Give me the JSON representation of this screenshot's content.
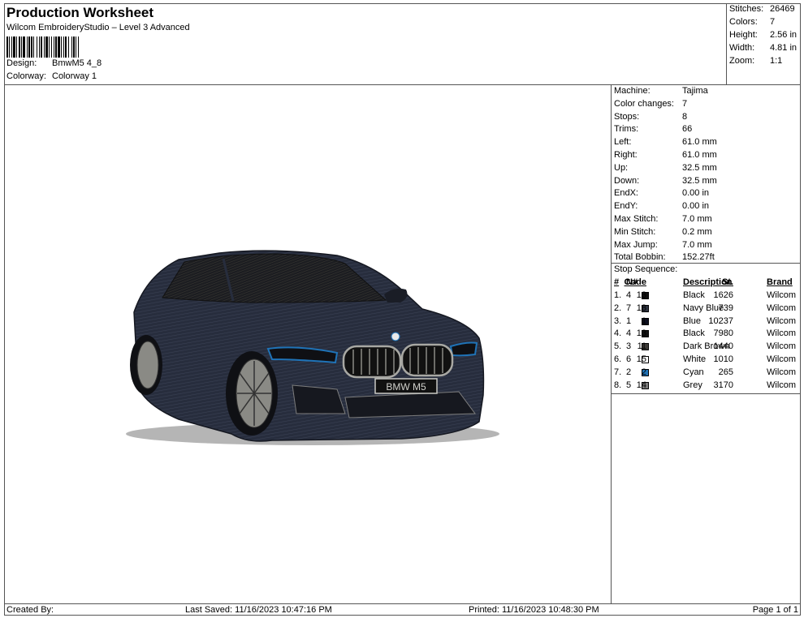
{
  "header": {
    "title": "Production Worksheet",
    "subtitle": "Wilcom EmbroideryStudio – Level 3 Advanced",
    "design_label": "Design:",
    "design_value": "BmwM5 4_8",
    "colorway_label": "Colorway:",
    "colorway_value": "Colorway 1"
  },
  "stats": {
    "stitches_label": "Stitches:",
    "stitches_value": "26469",
    "colors_label": "Colors:",
    "colors_value": "7",
    "height_label": "Height:",
    "height_value": "2.56 in",
    "width_label": "Width:",
    "width_value": "4.81 in",
    "zoom_label": "Zoom:",
    "zoom_value": "1:1"
  },
  "machine": [
    {
      "label": "Machine:",
      "value": "Tajima"
    },
    {
      "label": "Color changes:",
      "value": "7"
    },
    {
      "label": "Stops:",
      "value": "8"
    },
    {
      "label": "Trims:",
      "value": "66"
    },
    {
      "label": "Left:",
      "value": "61.0 mm"
    },
    {
      "label": "Right:",
      "value": "61.0 mm"
    },
    {
      "label": "Up:",
      "value": "32.5 mm"
    },
    {
      "label": "Down:",
      "value": "32.5 mm"
    },
    {
      "label": "EndX:",
      "value": "0.00 in"
    },
    {
      "label": "EndY:",
      "value": "0.00 in"
    },
    {
      "label": "Max Stitch:",
      "value": "7.0 mm"
    },
    {
      "label": "Min Stitch:",
      "value": "0.2 mm"
    },
    {
      "label": "Max Jump:",
      "value": "7.0 mm"
    },
    {
      "label": "Total Bobbin:",
      "value": "152.27ft"
    }
  ],
  "sequence": {
    "title": "Stop Sequence:",
    "headers": {
      "num": "#",
      "n": "N#",
      "st": "St.",
      "desc": "Description",
      "code": "Code",
      "brand": "Brand"
    },
    "rows": [
      {
        "num": "1.",
        "n": "4",
        "color": "#111111",
        "st": "1626",
        "desc": "Black",
        "code": "13",
        "brand": "Wilcom"
      },
      {
        "num": "2.",
        "n": "7",
        "color": "#2e3440",
        "st": "739",
        "desc": "Navy Blue",
        "code": "18",
        "brand": "Wilcom"
      },
      {
        "num": "3.",
        "n": "1",
        "color": "#0c0f1e",
        "st": "10237",
        "desc": "Blue",
        "code": "1",
        "brand": "Wilcom"
      },
      {
        "num": "4.",
        "n": "4",
        "color": "#111111",
        "st": "7980",
        "desc": "Black",
        "code": "13",
        "brand": "Wilcom"
      },
      {
        "num": "5.",
        "n": "3",
        "color": "#3d3b38",
        "st": "1440",
        "desc": "Dark Brown",
        "code": "11",
        "brand": "Wilcom"
      },
      {
        "num": "6.",
        "n": "6",
        "color": "#ffffff",
        "st": "1010",
        "desc": "White",
        "code": "15",
        "brand": "Wilcom"
      },
      {
        "num": "7.",
        "n": "2",
        "color": "#1f73b7",
        "st": "265",
        "desc": "Cyan",
        "code": "2",
        "brand": "Wilcom"
      },
      {
        "num": "8.",
        "n": "5",
        "color": "#7d7d7d",
        "st": "3170",
        "desc": "Grey",
        "code": "14",
        "brand": "Wilcom"
      }
    ]
  },
  "design_preview": {
    "plate_text": "BMW M5",
    "colors": {
      "body": "#272d3d",
      "glass": "#1c1d21",
      "accent": "#1f73b7",
      "grey": "#8a8a85"
    }
  },
  "footer": {
    "created_by": "Created By:",
    "last_saved": "Last Saved: 11/16/2023 10:47:16 PM",
    "printed": "Printed: 11/16/2023 10:48:30 PM",
    "page": "Page 1 of 1"
  }
}
